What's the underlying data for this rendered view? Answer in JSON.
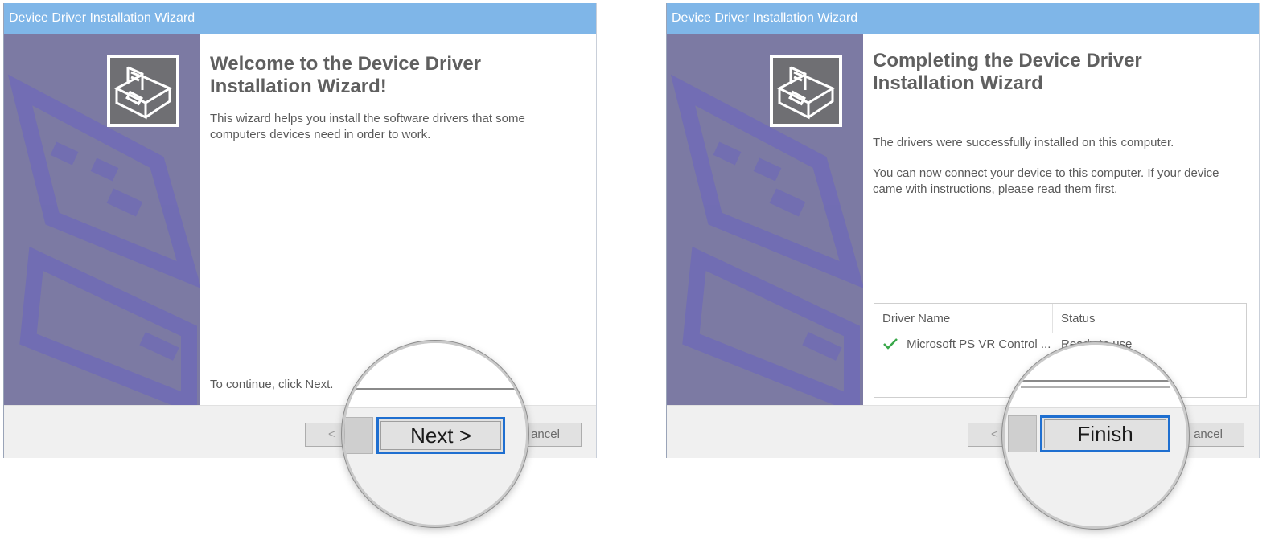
{
  "wizard1": {
    "title": "Device Driver Installation Wizard",
    "heading_line1": "Welcome to the Device Driver",
    "heading_line2": "Installation Wizard!",
    "description": "This wizard helps you install the software drivers that some computers devices need in order to work.",
    "continue_text": "To continue, click Next.",
    "back_label": "<",
    "next_label": "Next >",
    "cancel_label": "ancel"
  },
  "wizard2": {
    "title": "Device Driver Installation Wizard",
    "heading_line1": "Completing the Device Driver",
    "heading_line2": "Installation Wizard",
    "success_text": "The drivers were successfully installed on this computer.",
    "connect_text": "You can now connect your device to this computer. If your device came with instructions, please read them first.",
    "list": {
      "columns": [
        "Driver Name",
        "Status"
      ],
      "rows": [
        {
          "name": "Microsoft PS VR Control ...",
          "status": "Ready to use"
        }
      ]
    },
    "back_label": "<",
    "finish_label": "Finish",
    "cancel_label": "ancel"
  },
  "icons": {
    "wizard": "driver-box-icon",
    "check": "green-check-icon"
  },
  "colors": {
    "titlebar": "#7fb6e8",
    "banner": "#7c7aa3",
    "focus_border": "#1f6fd0",
    "check": "#3aa84a"
  }
}
